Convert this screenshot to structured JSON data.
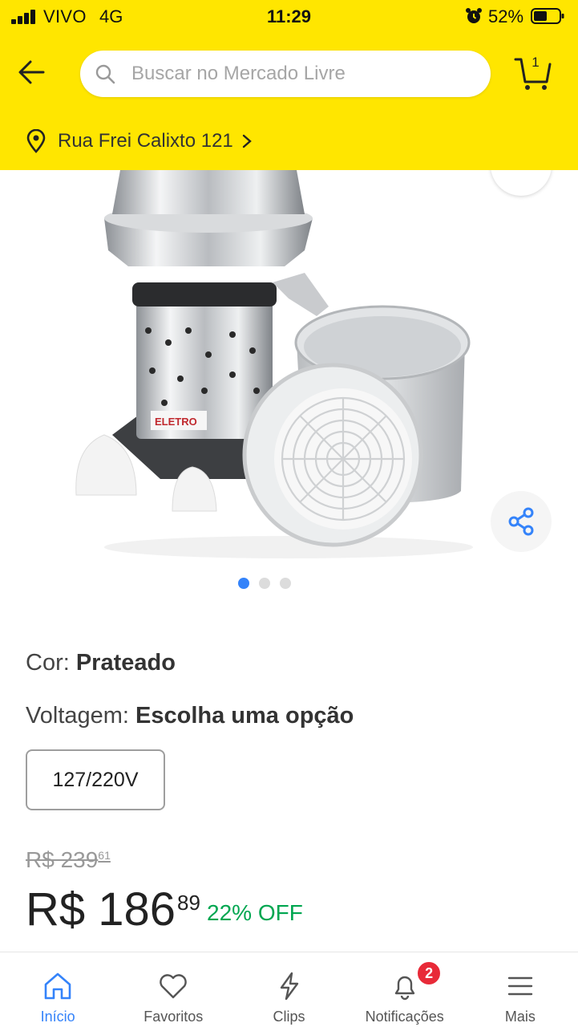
{
  "status_bar": {
    "carrier": "VIVO",
    "network": "4G",
    "time": "11:29",
    "battery": "52%"
  },
  "header": {
    "search_placeholder": "Buscar no Mercado Livre",
    "cart_count": "1",
    "address": "Rua Frei Calixto 121",
    "accent_color": "#ffe600"
  },
  "gallery": {
    "image_label": "ELETRO",
    "page_count": 3,
    "current_page": 1
  },
  "product": {
    "color_label": "Cor: ",
    "color_value": "Prateado",
    "voltage_label": "Voltagem: ",
    "voltage_value": "Escolha uma opção",
    "voltage_option": "127/220V",
    "old_price_int": "R$ 239",
    "old_price_cents": "61",
    "price_int": "R$ 186",
    "price_cents": "89",
    "discount": "22% OFF"
  },
  "bottom_nav": {
    "items": [
      {
        "label": "Início",
        "icon": "home-icon",
        "active": true
      },
      {
        "label": "Favoritos",
        "icon": "heart-icon"
      },
      {
        "label": "Clips",
        "icon": "lightning-icon"
      },
      {
        "label": "Notificações",
        "icon": "bell-icon",
        "badge": "2"
      },
      {
        "label": "Mais",
        "icon": "menu-icon"
      }
    ]
  },
  "colors": {
    "primary_blue": "#3483fa",
    "discount_green": "#00a650",
    "badge_red": "#e82a38"
  }
}
